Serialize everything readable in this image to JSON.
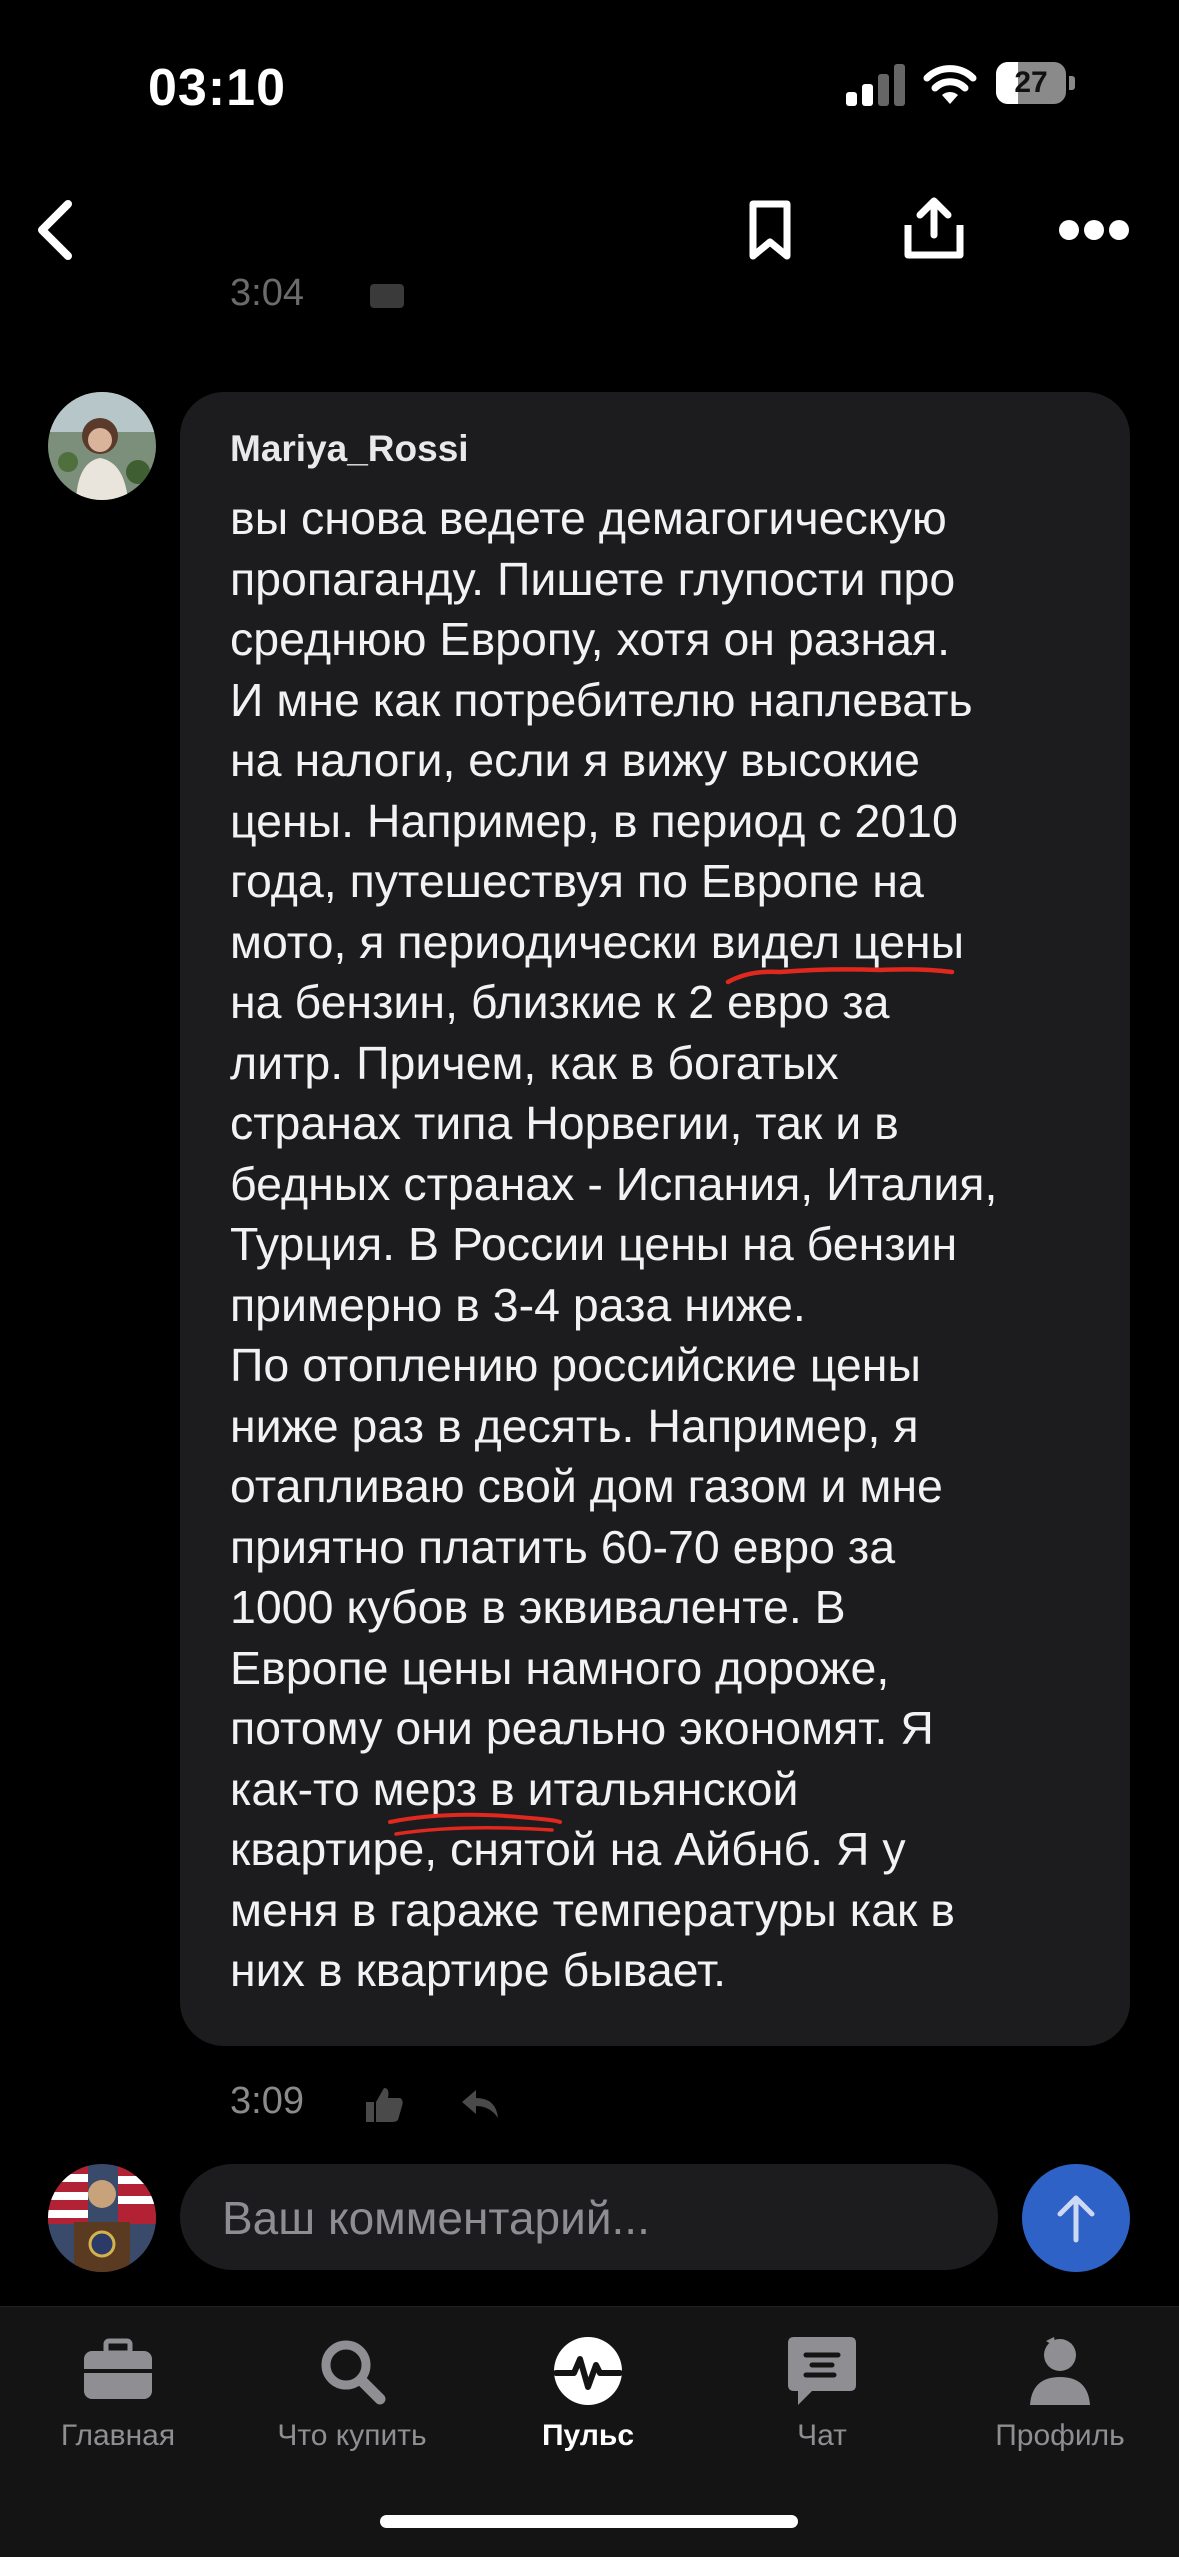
{
  "status_bar": {
    "time": "03:10",
    "battery": "27"
  },
  "thread": {
    "previous_time": "3:04"
  },
  "comment": {
    "author": "Mariya_Rossi",
    "text": "вы снова ведете демагогическую\nпропаганду. Пишете глупости про\nсреднюю Европу, хотя он разная.\nИ мне как потребителю наплевать\nна налоги, если я вижу высокие\nцены. Например, в период с 2010\nгода, путешествуя по Европе на\nмото, я периодически видел цены\nна бензин, близкие к 2 евро за\nлитр. Причем, как в богатых\nстранах типа Норвегии, так и в\nбедных странах - Испания, Италия,\nТурция. В России цены на бензин\nпримерно в 3-4 раза ниже.\nПо отоплению российские цены\nниже раз в десять. Например, я\nотапливаю свой дом газом и мне\nприятно платить 60-70 евро за\n1000 кубов в эквиваленте. В\nЕвропе цены намного дороже,\nпотому они реально экономят. Я\nкак-то мерз в итальянской\nквартире, снятой на Айбнб. Я у\nменя в гараже температуры как в\nних в квартире бывает.",
    "time": "3:09"
  },
  "composer": {
    "placeholder": "Ваш комментарий..."
  },
  "tabs": [
    {
      "label": "Главная",
      "icon": "briefcase-icon"
    },
    {
      "label": "Что купить",
      "icon": "search-icon"
    },
    {
      "label": "Пульс",
      "icon": "pulse-icon",
      "active": true
    },
    {
      "label": "Чат",
      "icon": "chat-icon"
    },
    {
      "label": "Профиль",
      "icon": "profile-icon"
    }
  ],
  "colors": {
    "accent": "#2f62c6",
    "bubble": "#1c1c1e",
    "underline": "#e0281e"
  }
}
